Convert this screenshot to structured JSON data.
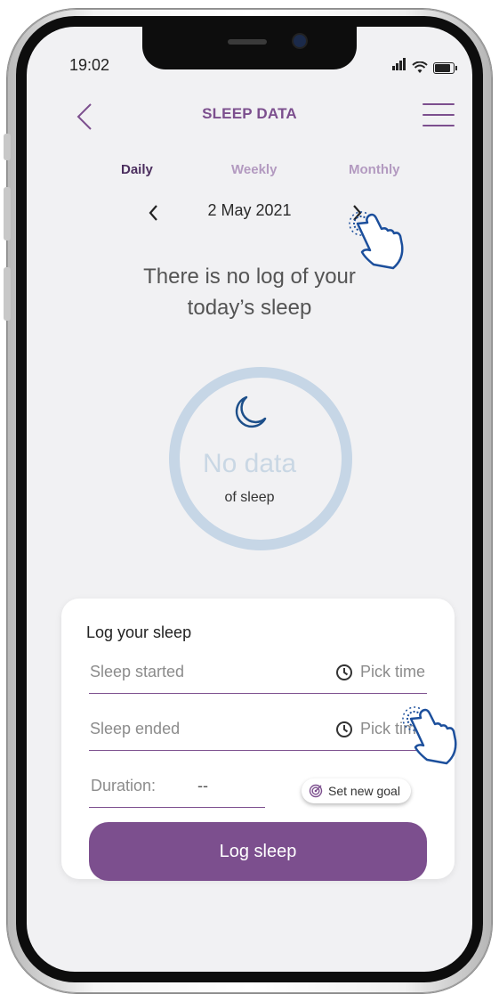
{
  "status_bar": {
    "time": "19:02"
  },
  "header": {
    "title": "SLEEP DATA"
  },
  "tabs": [
    {
      "label": "Daily",
      "active": true
    },
    {
      "label": "Weekly",
      "active": false
    },
    {
      "label": "Monthly",
      "active": false
    }
  ],
  "date_nav": {
    "date": "2 May 2021"
  },
  "message": {
    "line1": "There is no log of your",
    "line2": "today’s sleep"
  },
  "ring": {
    "main": "No data",
    "sub": "of sleep",
    "icon": "moon-icon"
  },
  "log_card": {
    "title": "Log your sleep",
    "sleep_started": {
      "label": "Sleep started",
      "pick": "Pick time"
    },
    "sleep_ended": {
      "label": "Sleep ended",
      "pick": "Pick time"
    },
    "duration": {
      "label": "Duration:",
      "value": "--"
    },
    "goal_button": "Set new goal",
    "log_button": "Log sleep"
  },
  "colors": {
    "accent": "#7c4f8e",
    "tab_inactive": "#b39ac0",
    "ring": "#c6d6e6",
    "background": "#f1f1f3",
    "hand_outline": "#1c4f9c",
    "moon": "#1d4f8a"
  }
}
